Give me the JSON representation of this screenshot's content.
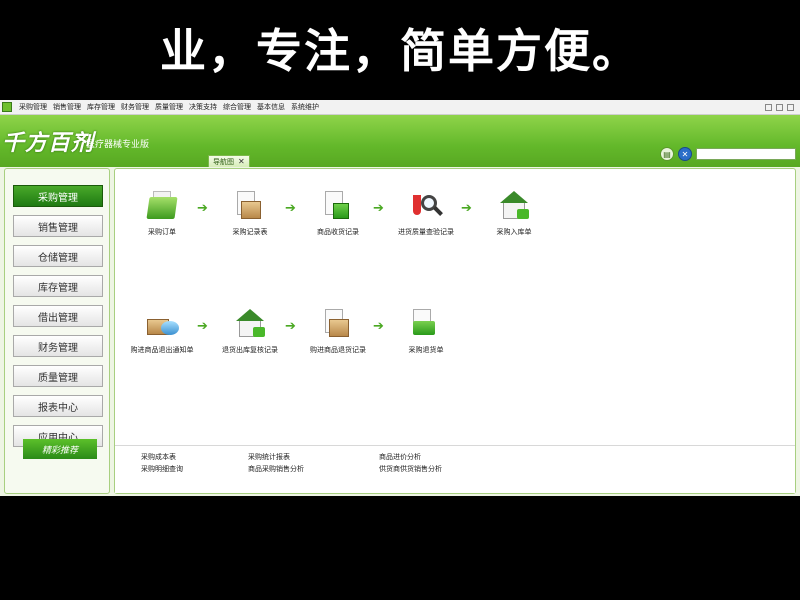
{
  "caption": "业，专注，简单方便。",
  "menu": [
    "采购管理",
    "销售管理",
    "库存管理",
    "财务管理",
    "质量管理",
    "决策支持",
    "综合管理",
    "基本信息",
    "系统维护"
  ],
  "logo": "千方百剂",
  "edition": "医疗器械专业版",
  "tab": {
    "label": "导航图",
    "close": "✕"
  },
  "sidebar": [
    {
      "label": "采购管理",
      "active": true
    },
    {
      "label": "销售管理"
    },
    {
      "label": "仓储管理"
    },
    {
      "label": "库存管理"
    },
    {
      "label": "借出管理"
    },
    {
      "label": "财务管理"
    },
    {
      "label": "质量管理"
    },
    {
      "label": "报表中心"
    },
    {
      "label": "应用中心"
    }
  ],
  "promo": "精彩推荐",
  "flow_row1": [
    {
      "label": "采购订单",
      "icon": "folder-icon"
    },
    {
      "label": "采购记录表",
      "icon": "document-box-icon"
    },
    {
      "label": "商品收货记录",
      "icon": "receive-goods-icon"
    },
    {
      "label": "进货质量查验记录",
      "icon": "inspection-icon"
    },
    {
      "label": "采购入库单",
      "icon": "warehouse-in-icon"
    }
  ],
  "flow_row2": [
    {
      "label": "购进商品退出通知单",
      "icon": "return-notice-icon"
    },
    {
      "label": "退货出库复核记录",
      "icon": "return-review-icon"
    },
    {
      "label": "购进商品退货记录",
      "icon": "return-record-icon"
    },
    {
      "label": "采购退货单",
      "icon": "return-order-icon"
    }
  ],
  "arrow": "➔",
  "footer": {
    "col1": [
      "采购成本表",
      "采购明细查询"
    ],
    "col2": [
      "采购统计报表",
      "商品采购销售分析"
    ],
    "col3": [
      "商品进价分析",
      "供货商供货销售分析"
    ]
  }
}
